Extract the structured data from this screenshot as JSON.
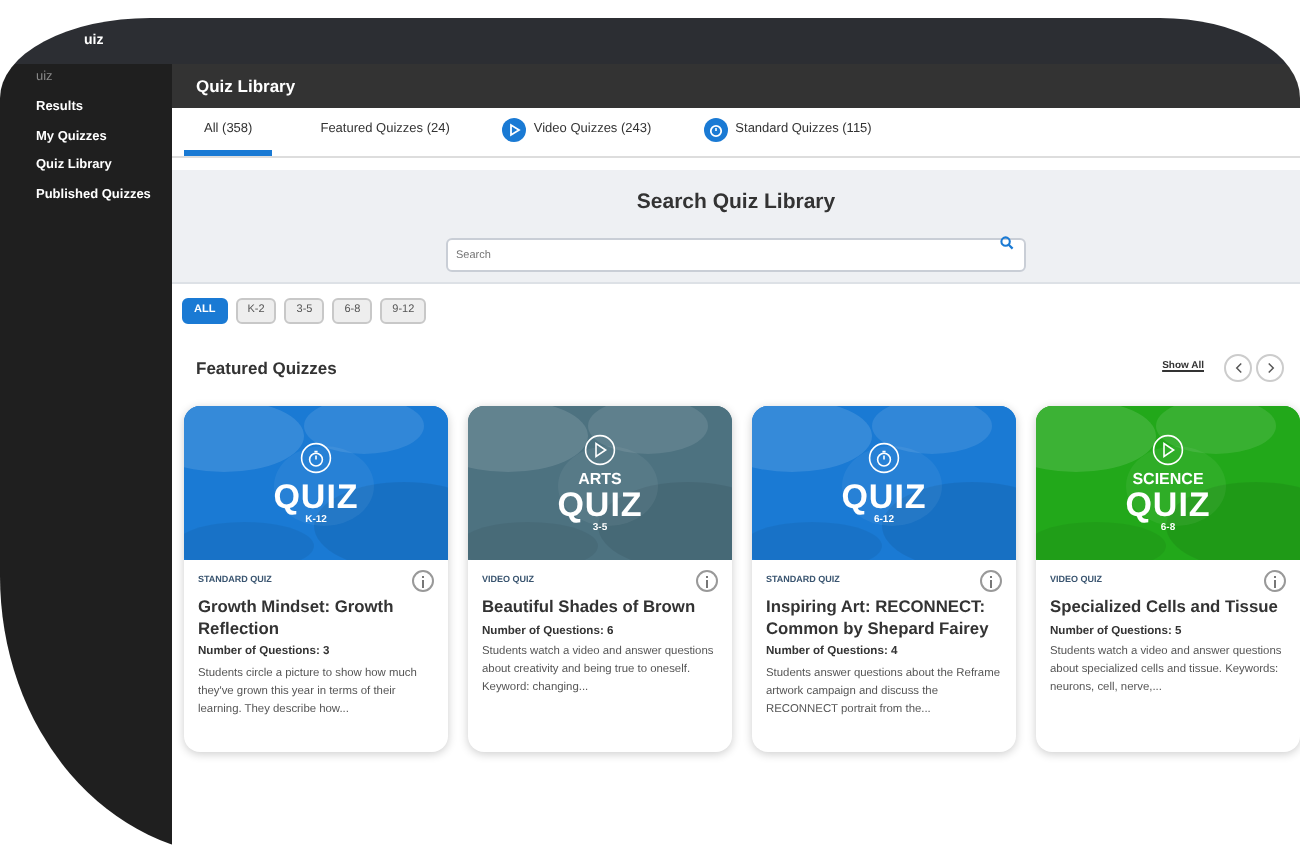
{
  "app_bar": {
    "title": "uiz"
  },
  "sidebar": {
    "heading": "uiz",
    "items": [
      {
        "label": "Results"
      },
      {
        "label": "My Quizzes"
      },
      {
        "label": "Quiz Library"
      },
      {
        "label": "Published Quizzes"
      }
    ]
  },
  "page_title": "Quiz Library",
  "tabs": [
    {
      "label": "All (358)",
      "selected": true,
      "kind": "plain"
    },
    {
      "label": "Featured Quizzes (24)",
      "selected": false,
      "kind": "plain"
    },
    {
      "label": "Video Quizzes (243)",
      "selected": false,
      "kind": "video"
    },
    {
      "label": "Standard Quizzes (115)",
      "selected": false,
      "kind": "standard"
    }
  ],
  "search": {
    "heading": "Search Quiz Library",
    "placeholder": "Search"
  },
  "grade_filters": [
    {
      "label": "ALL",
      "selected": true
    },
    {
      "label": "K-2",
      "selected": false
    },
    {
      "label": "3-5",
      "selected": false
    },
    {
      "label": "6-8",
      "selected": false
    },
    {
      "label": "9-12",
      "selected": false
    }
  ],
  "featured": {
    "heading": "Featured Quizzes",
    "show_all": "Show All",
    "cards": [
      {
        "kind": "standard",
        "color": "#1a7ad4",
        "badge": "QUIZ",
        "grades": "K-12",
        "type_label": "STANDARD QUIZ",
        "title": "Growth Mindset: Growth Reflection",
        "questions": "Number of Questions: 3",
        "description": "Students circle a picture to show how much they've grown this year in terms of their learning. They describe how..."
      },
      {
        "kind": "video",
        "color": "#4d7280",
        "subject": "ARTS",
        "badge": "QUIZ",
        "grades": "3-5",
        "type_label": "VIDEO QUIZ",
        "title": "Beautiful Shades of Brown",
        "questions": "Number of Questions: 6",
        "description": "Students watch a video and answer questions about creativity and being true to oneself. Keyword: changing..."
      },
      {
        "kind": "standard",
        "color": "#1a7ad4",
        "badge": "QUIZ",
        "grades": "6-12",
        "type_label": "STANDARD QUIZ",
        "title": "Inspiring Art: RECONNECT: Common by Shepard Fairey",
        "questions": "Number of Questions: 4",
        "description": "Students answer questions about the Reframe artwork campaign and discuss the RECONNECT portrait from the..."
      },
      {
        "kind": "video",
        "color": "#22a81a",
        "subject": "SCIENCE",
        "badge": "QUIZ",
        "grades": "6-8",
        "type_label": "VIDEO QUIZ",
        "title": "Specialized Cells and Tissue",
        "questions": "Number of Questions: 5",
        "description": "Students watch a video and answer questions about specialized cells and tissue. Keywords: neurons, cell, nerve,..."
      }
    ]
  }
}
